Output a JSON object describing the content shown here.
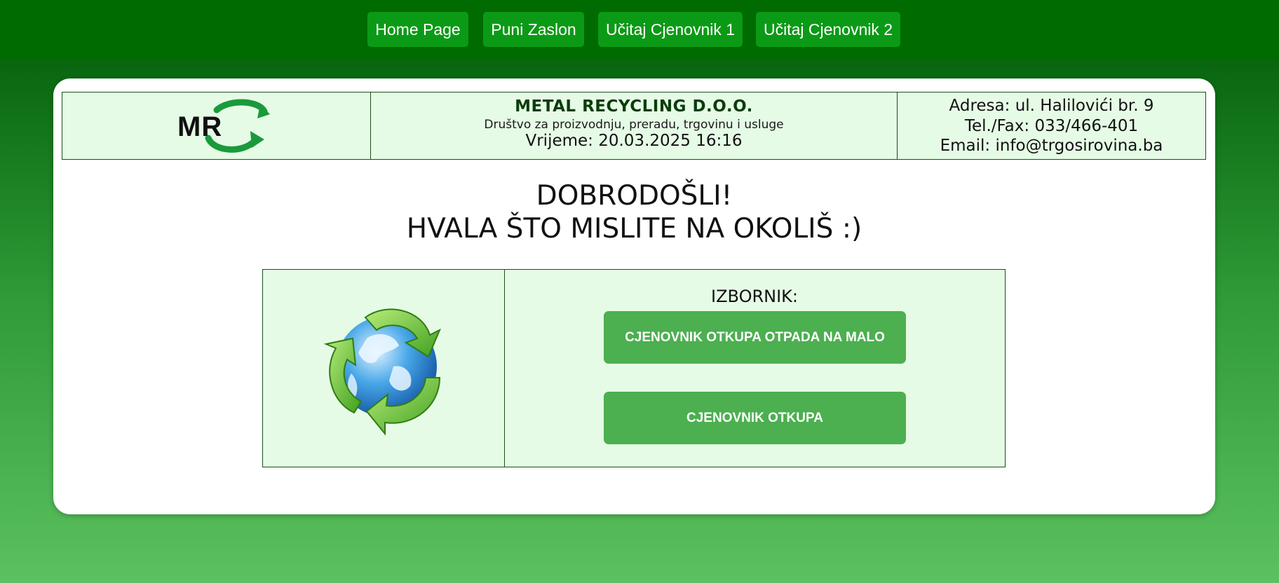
{
  "nav": {
    "items": [
      {
        "label": "Home Page"
      },
      {
        "label": "Puni Zaslon"
      },
      {
        "label": "Učitaj Cjenovnik 1"
      },
      {
        "label": "Učitaj Cjenovnik 2"
      }
    ]
  },
  "header": {
    "logo_text": "MR",
    "company_name": "METAL RECYCLING D.O.O.",
    "company_description": "Društvo za proizvodnju, preradu, trgovinu i usluge",
    "datetime": "Vrijeme: 20.03.2025 16:16",
    "address": "Adresa: ul. Halilovići br. 9",
    "phone": "Tel./Fax: 033/466-401",
    "email": "Email: info@trgosirovina.ba"
  },
  "welcome": {
    "line1": "DOBRODOŠLI!",
    "line2": "HVALA ŠTO MISLITE NA OKOLIŠ :)"
  },
  "menu": {
    "title": "IZBORNIK:",
    "buttons": [
      {
        "label": "CJENOVNIK OTKUPA OTPADA NA MALO"
      },
      {
        "label": "CJENOVNIK OTKUPA"
      }
    ]
  },
  "colors": {
    "topbar": "#006b00",
    "nav_button": "#0b9a16",
    "menu_button": "#4caf50",
    "panel_background": "#e6fbe6"
  },
  "icons": [
    "mr-logo-icon",
    "recycle-globe-icon"
  ]
}
